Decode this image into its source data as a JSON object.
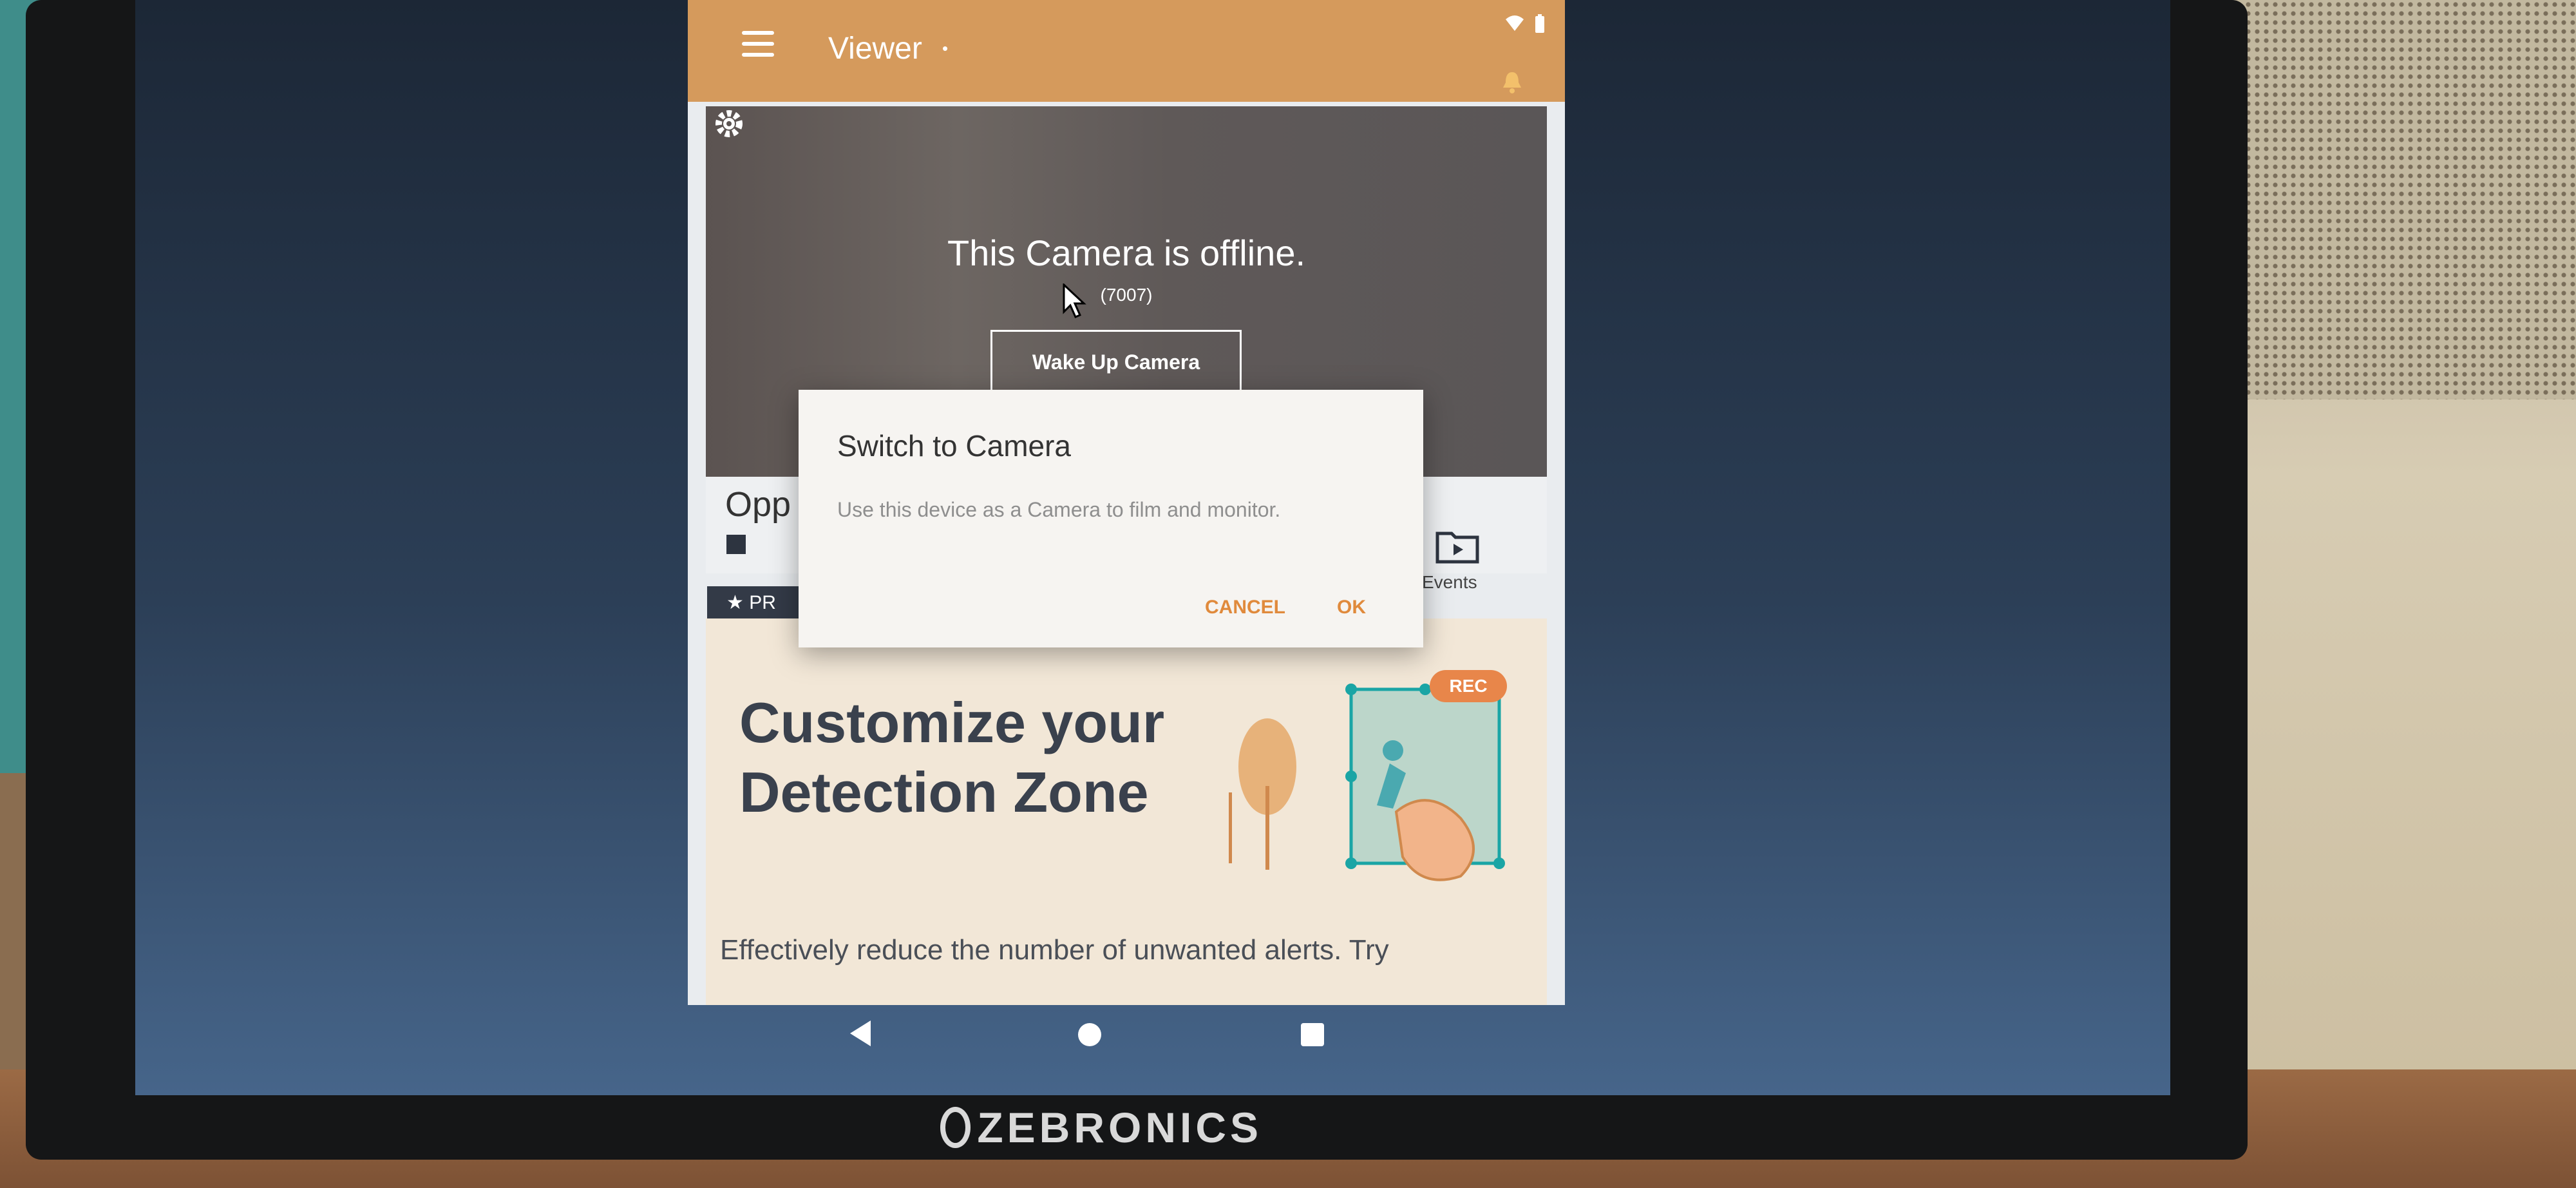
{
  "appbar": {
    "title": "Viewer"
  },
  "viewer": {
    "offline_title": "This Camera is offline.",
    "offline_code": "(7007)",
    "wake_button": "Wake Up Camera"
  },
  "camera": {
    "name": "Opp",
    "events_label": "Events"
  },
  "promo": {
    "tag": "★ PR",
    "title_line1": "Customize your",
    "title_line2": "Detection Zone",
    "badge": "REC",
    "description": "Effectively reduce the number of unwanted alerts. Try"
  },
  "dialog": {
    "title": "Switch to Camera",
    "message": "Use this device as a Camera to film and monitor.",
    "cancel": "CANCEL",
    "ok": "OK"
  },
  "monitor": {
    "brand": "ZEBRONICS"
  },
  "colors": {
    "appbar": "#d59a5c",
    "accent": "#e08a3c",
    "zone": "#1aa5a5"
  }
}
